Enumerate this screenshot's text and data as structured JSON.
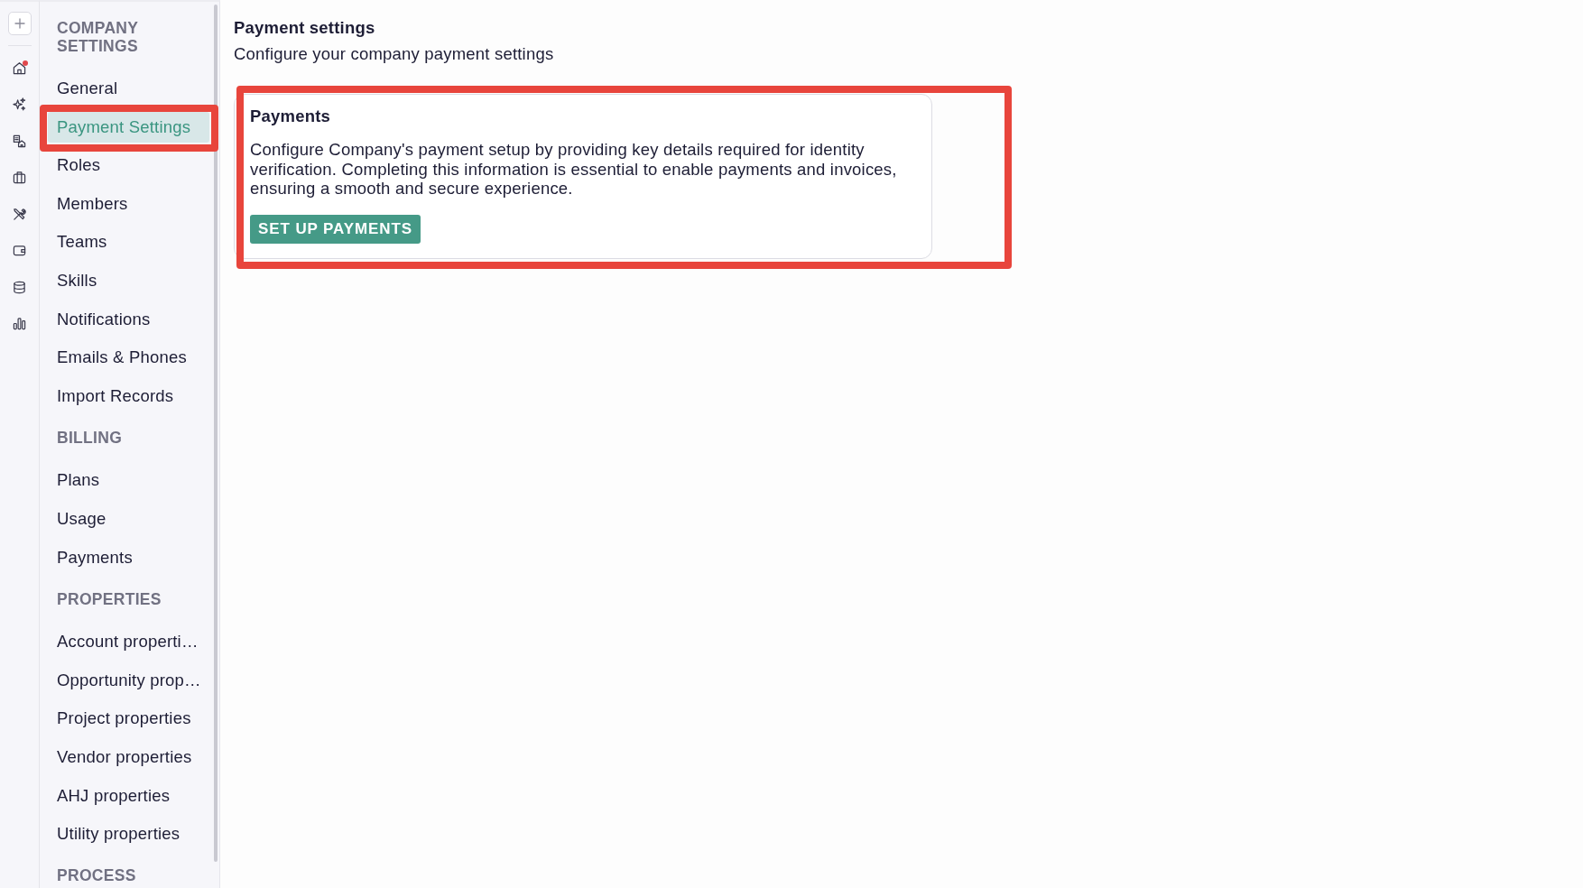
{
  "rail": {
    "home_alert": true
  },
  "sidebar": {
    "sections": [
      {
        "heading": "COMPANY SETTINGS",
        "items": [
          {
            "label": "General",
            "selected": false,
            "highlighted": false
          },
          {
            "label": "Payment Settings",
            "selected": true,
            "highlighted": true
          },
          {
            "label": "Roles",
            "selected": false,
            "highlighted": false
          },
          {
            "label": "Members",
            "selected": false,
            "highlighted": false
          },
          {
            "label": "Teams",
            "selected": false,
            "highlighted": false
          },
          {
            "label": "Skills",
            "selected": false,
            "highlighted": false
          },
          {
            "label": "Notifications",
            "selected": false,
            "highlighted": false
          },
          {
            "label": "Emails & Phones",
            "selected": false,
            "highlighted": false
          },
          {
            "label": "Import Records",
            "selected": false,
            "highlighted": false
          }
        ]
      },
      {
        "heading": "BILLING",
        "items": [
          {
            "label": "Plans",
            "selected": false,
            "highlighted": false
          },
          {
            "label": "Usage",
            "selected": false,
            "highlighted": false
          },
          {
            "label": "Payments",
            "selected": false,
            "highlighted": false
          }
        ]
      },
      {
        "heading": "PROPERTIES",
        "items": [
          {
            "label": "Account properti…",
            "selected": false,
            "highlighted": false
          },
          {
            "label": "Opportunity prop…",
            "selected": false,
            "highlighted": false
          },
          {
            "label": "Project properties",
            "selected": false,
            "highlighted": false
          },
          {
            "label": "Vendor properties",
            "selected": false,
            "highlighted": false
          },
          {
            "label": "AHJ properties",
            "selected": false,
            "highlighted": false
          },
          {
            "label": "Utility properties",
            "selected": false,
            "highlighted": false
          }
        ]
      },
      {
        "heading": "PROCESS"
      }
    ]
  },
  "header": {
    "title": "Payment settings",
    "subtitle": "Configure your company payment settings"
  },
  "card": {
    "title": "Payments",
    "text": "Configure Company's payment setup by providing key details required for identity verification. Completing this information is essential to enable payments and invoices, ensuring a smooth and secure experience.",
    "button": "SET UP PAYMENTS",
    "highlighted": true
  }
}
